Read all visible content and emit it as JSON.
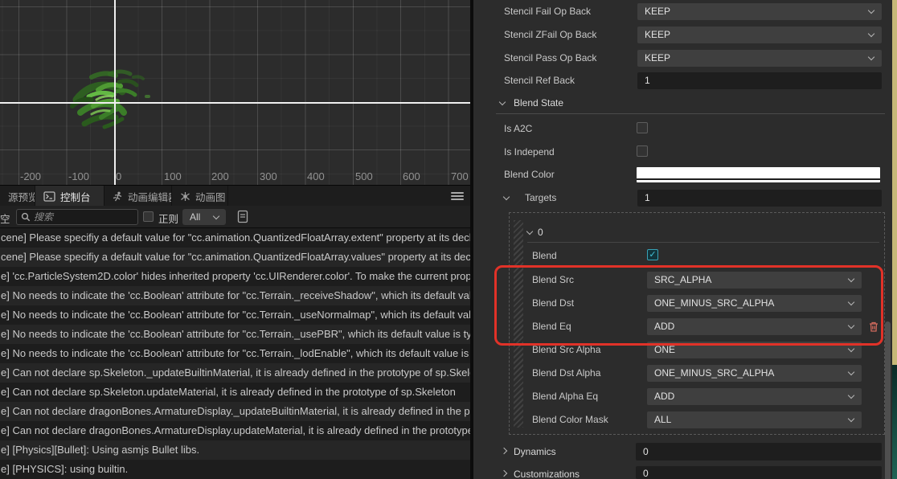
{
  "scene": {
    "ruler_labels": [
      "-200",
      "-100",
      "0",
      "100",
      "200",
      "300",
      "400",
      "500",
      "600",
      "700"
    ]
  },
  "tabs": {
    "preview": "源预览",
    "console": "控制台",
    "anim_editor": "动画编辑器",
    "anim_graph": "动画图"
  },
  "console_toolbar": {
    "clear_label": "空",
    "search_placeholder": "搜索",
    "regex_label": "正则",
    "filter_value": "All"
  },
  "console": {
    "rows": [
      "cene] Please specifiy a default value for \"cc.animation.QuantizedFloatArray.extent\" property at its declar",
      "cene] Please specifiy a default value for \"cc.animation.QuantizedFloatArray.values\" property at its declar",
      "e] 'cc.ParticleSystem2D.color' hides inherited property 'cc.UIRenderer.color'. To make the current prope",
      "e] No needs to indicate the 'cc.Boolean' attribute for \"cc.Terrain._receiveShadow\", which its default valu",
      "e] No needs to indicate the 'cc.Boolean' attribute for \"cc.Terrain._useNormalmap\", which its default valu",
      "e] No needs to indicate the 'cc.Boolean' attribute for \"cc.Terrain._usePBR\", which its default value is typ",
      "e] No needs to indicate the 'cc.Boolean' attribute for \"cc.Terrain._lodEnable\", which its default value is ty",
      "e] Can not declare sp.Skeleton._updateBuiltinMaterial, it is already defined in the prototype of sp.Skelet",
      "e] Can not declare sp.Skeleton.updateMaterial, it is already defined in the prototype of sp.Skeleton",
      "e] Can not declare dragonBones.ArmatureDisplay._updateBuiltinMaterial, it is already defined in the prot",
      "e] Can not declare dragonBones.ArmatureDisplay.updateMaterial, it is already defined in the prototype o",
      "e] [Physics][Bullet]: Using asmjs Bullet libs.",
      "e] [PHYSICS]: using builtin."
    ]
  },
  "inspector": {
    "stencil_rows": [
      {
        "label": "Stencil Fail Op Back",
        "value": "KEEP"
      },
      {
        "label": "Stencil ZFail Op Back",
        "value": "KEEP"
      },
      {
        "label": "Stencil Pass Op Back",
        "value": "KEEP"
      },
      {
        "label": "Stencil Ref Back",
        "value": "1"
      }
    ],
    "blend_state": {
      "header": "Blend State",
      "is_a2c_label": "Is A2C",
      "is_independ_label": "Is Independ",
      "blend_color_label": "Blend Color",
      "targets_label": "Targets",
      "targets_value": "1",
      "target0": {
        "header": "0",
        "blend_label": "Blend",
        "rows": [
          {
            "label": "Blend Src",
            "value": "SRC_ALPHA"
          },
          {
            "label": "Blend Dst",
            "value": "ONE_MINUS_SRC_ALPHA"
          },
          {
            "label": "Blend Eq",
            "value": "ADD"
          },
          {
            "label": "Blend Src Alpha",
            "value": "ONE"
          },
          {
            "label": "Blend Dst Alpha",
            "value": "ONE_MINUS_SRC_ALPHA"
          },
          {
            "label": "Blend Alpha Eq",
            "value": "ADD"
          },
          {
            "label": "Blend Color Mask",
            "value": "ALL"
          }
        ]
      }
    },
    "dynamics": {
      "label": "Dynamics",
      "value": "0"
    },
    "customizations": {
      "label": "Customizations",
      "value": "0"
    }
  },
  "colors": {
    "highlight_red": "#e13228",
    "blend_color_value": "#ffffff",
    "checkbox_teal": "#37a2b6",
    "edge_tan": "#c6b878",
    "edge_teal_dark": "#0b2a27",
    "edge_teal_light": "#1f6455"
  },
  "check_glyph": "✓"
}
